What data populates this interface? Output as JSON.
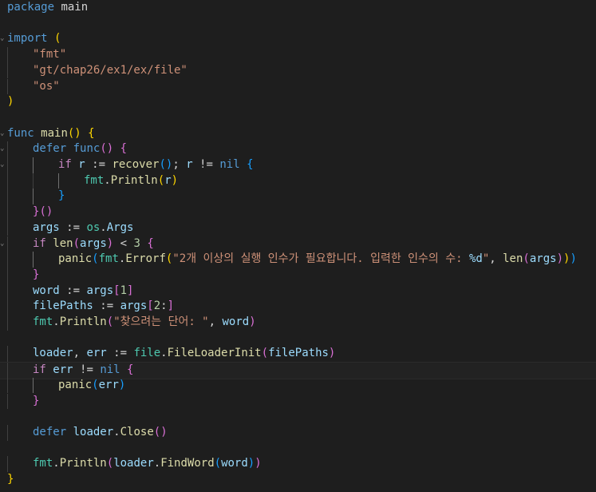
{
  "colors": {
    "background": "#1e1e1e",
    "keyword": "#569cd6",
    "control": "#c586c0",
    "function": "#dcdcaa",
    "string": "#ce9178",
    "variable": "#9cdcfe",
    "type": "#4ec9b0",
    "number": "#b5cea8",
    "plain": "#d4d4d4",
    "bracket1": "#ffd700",
    "bracket2": "#da70d6",
    "bracket3": "#179fff"
  },
  "lines": [
    {
      "indent": 0,
      "tokens": [
        [
          "package",
          "keyword"
        ],
        [
          " main",
          "plain"
        ]
      ]
    },
    {
      "indent": 0,
      "tokens": []
    },
    {
      "indent": 0,
      "fold": true,
      "tokens": [
        [
          "import",
          "keyword"
        ],
        [
          " ",
          "plain"
        ],
        [
          "(",
          "bracket1"
        ]
      ]
    },
    {
      "indent": 1,
      "tokens": [
        [
          "\"fmt\"",
          "string"
        ]
      ]
    },
    {
      "indent": 1,
      "tokens": [
        [
          "\"gt/chap26/ex1/ex/file\"",
          "string"
        ]
      ]
    },
    {
      "indent": 1,
      "tokens": [
        [
          "\"os\"",
          "string"
        ]
      ]
    },
    {
      "indent": 0,
      "tokens": [
        [
          ")",
          "bracket1"
        ]
      ]
    },
    {
      "indent": 0,
      "tokens": []
    },
    {
      "indent": 0,
      "fold": true,
      "tokens": [
        [
          "func",
          "keyword"
        ],
        [
          " ",
          "plain"
        ],
        [
          "main",
          "function"
        ],
        [
          "()",
          "bracket1"
        ],
        [
          " ",
          "plain"
        ],
        [
          "{",
          "bracket1"
        ]
      ]
    },
    {
      "indent": 1,
      "fold": true,
      "tokens": [
        [
          "defer",
          "keyword"
        ],
        [
          " ",
          "plain"
        ],
        [
          "func",
          "keyword"
        ],
        [
          "()",
          "bracket2"
        ],
        [
          " ",
          "plain"
        ],
        [
          "{",
          "bracket2"
        ]
      ]
    },
    {
      "indent": 2,
      "fold": true,
      "tokens": [
        [
          "if",
          "control"
        ],
        [
          " ",
          "plain"
        ],
        [
          "r",
          "variable"
        ],
        [
          " := ",
          "plain"
        ],
        [
          "recover",
          "function"
        ],
        [
          "()",
          "bracket3"
        ],
        [
          "; ",
          "plain"
        ],
        [
          "r",
          "variable"
        ],
        [
          " != ",
          "plain"
        ],
        [
          "nil",
          "keyword"
        ],
        [
          " ",
          "plain"
        ],
        [
          "{",
          "bracket3"
        ]
      ]
    },
    {
      "indent": 3,
      "tokens": [
        [
          "fmt",
          "type"
        ],
        [
          ".",
          "plain"
        ],
        [
          "Println",
          "function"
        ],
        [
          "(",
          "bracket1"
        ],
        [
          "r",
          "variable"
        ],
        [
          ")",
          "bracket1"
        ]
      ]
    },
    {
      "indent": 2,
      "tokens": [
        [
          "}",
          "bracket3"
        ]
      ]
    },
    {
      "indent": 1,
      "tokens": [
        [
          "}",
          "bracket2"
        ],
        [
          "()",
          "bracket2"
        ]
      ]
    },
    {
      "indent": 1,
      "tokens": [
        [
          "args",
          "variable"
        ],
        [
          " := ",
          "plain"
        ],
        [
          "os",
          "type"
        ],
        [
          ".",
          "plain"
        ],
        [
          "Args",
          "variable"
        ]
      ]
    },
    {
      "indent": 1,
      "fold": true,
      "tokens": [
        [
          "if",
          "control"
        ],
        [
          " ",
          "plain"
        ],
        [
          "len",
          "function"
        ],
        [
          "(",
          "bracket2"
        ],
        [
          "args",
          "variable"
        ],
        [
          ")",
          "bracket2"
        ],
        [
          " < ",
          "plain"
        ],
        [
          "3",
          "number"
        ],
        [
          " ",
          "plain"
        ],
        [
          "{",
          "bracket2"
        ]
      ]
    },
    {
      "indent": 2,
      "tokens": [
        [
          "panic",
          "function"
        ],
        [
          "(",
          "bracket3"
        ],
        [
          "fmt",
          "type"
        ],
        [
          ".",
          "plain"
        ],
        [
          "Errorf",
          "function"
        ],
        [
          "(",
          "bracket1"
        ],
        [
          "\"2개 이상의 실행 인수가 필요합니다. 입력한 인수의 수: ",
          "string"
        ],
        [
          "%d",
          "variable"
        ],
        [
          "\"",
          "string"
        ],
        [
          ", ",
          "plain"
        ],
        [
          "len",
          "function"
        ],
        [
          "(",
          "bracket2"
        ],
        [
          "args",
          "variable"
        ],
        [
          ")",
          "bracket2"
        ],
        [
          ")",
          "bracket1"
        ],
        [
          ")",
          "bracket3"
        ]
      ]
    },
    {
      "indent": 1,
      "tokens": [
        [
          "}",
          "bracket2"
        ]
      ]
    },
    {
      "indent": 1,
      "tokens": [
        [
          "word",
          "variable"
        ],
        [
          " := ",
          "plain"
        ],
        [
          "args",
          "variable"
        ],
        [
          "[",
          "bracket2"
        ],
        [
          "1",
          "number"
        ],
        [
          "]",
          "bracket2"
        ]
      ]
    },
    {
      "indent": 1,
      "tokens": [
        [
          "filePaths",
          "variable"
        ],
        [
          " := ",
          "plain"
        ],
        [
          "args",
          "variable"
        ],
        [
          "[",
          "bracket2"
        ],
        [
          "2",
          "number"
        ],
        [
          ":",
          "plain"
        ],
        [
          "]",
          "bracket2"
        ]
      ]
    },
    {
      "indent": 1,
      "tokens": [
        [
          "fmt",
          "type"
        ],
        [
          ".",
          "plain"
        ],
        [
          "Println",
          "function"
        ],
        [
          "(",
          "bracket2"
        ],
        [
          "\"찾으려는 단어: \"",
          "string"
        ],
        [
          ", ",
          "plain"
        ],
        [
          "word",
          "variable"
        ],
        [
          ")",
          "bracket2"
        ]
      ]
    },
    {
      "indent": 0,
      "tokens": []
    },
    {
      "indent": 1,
      "tokens": [
        [
          "loader",
          "variable"
        ],
        [
          ", ",
          "plain"
        ],
        [
          "err",
          "variable"
        ],
        [
          " := ",
          "plain"
        ],
        [
          "file",
          "type"
        ],
        [
          ".",
          "plain"
        ],
        [
          "FileLoaderInit",
          "function"
        ],
        [
          "(",
          "bracket2"
        ],
        [
          "filePaths",
          "variable"
        ],
        [
          ")",
          "bracket2"
        ]
      ]
    },
    {
      "indent": 1,
      "current": true,
      "tokens": [
        [
          "if",
          "control"
        ],
        [
          " ",
          "plain"
        ],
        [
          "err",
          "variable"
        ],
        [
          " != ",
          "plain"
        ],
        [
          "nil",
          "keyword"
        ],
        [
          " ",
          "plain"
        ],
        [
          "{",
          "bracket2"
        ]
      ]
    },
    {
      "indent": 2,
      "tokens": [
        [
          "panic",
          "function"
        ],
        [
          "(",
          "bracket3"
        ],
        [
          "err",
          "variable"
        ],
        [
          ")",
          "bracket3"
        ]
      ]
    },
    {
      "indent": 1,
      "tokens": [
        [
          "}",
          "bracket2"
        ]
      ]
    },
    {
      "indent": 0,
      "tokens": []
    },
    {
      "indent": 1,
      "tokens": [
        [
          "defer",
          "keyword"
        ],
        [
          " ",
          "plain"
        ],
        [
          "loader",
          "variable"
        ],
        [
          ".",
          "plain"
        ],
        [
          "Close",
          "function"
        ],
        [
          "()",
          "bracket2"
        ]
      ]
    },
    {
      "indent": 0,
      "tokens": []
    },
    {
      "indent": 1,
      "tokens": [
        [
          "fmt",
          "type"
        ],
        [
          ".",
          "plain"
        ],
        [
          "Println",
          "function"
        ],
        [
          "(",
          "bracket2"
        ],
        [
          "loader",
          "variable"
        ],
        [
          ".",
          "plain"
        ],
        [
          "FindWord",
          "function"
        ],
        [
          "(",
          "bracket3"
        ],
        [
          "word",
          "variable"
        ],
        [
          ")",
          "bracket3"
        ],
        [
          ")",
          "bracket2"
        ]
      ]
    },
    {
      "indent": 0,
      "tokens": [
        [
          "}",
          "bracket1"
        ]
      ]
    }
  ]
}
